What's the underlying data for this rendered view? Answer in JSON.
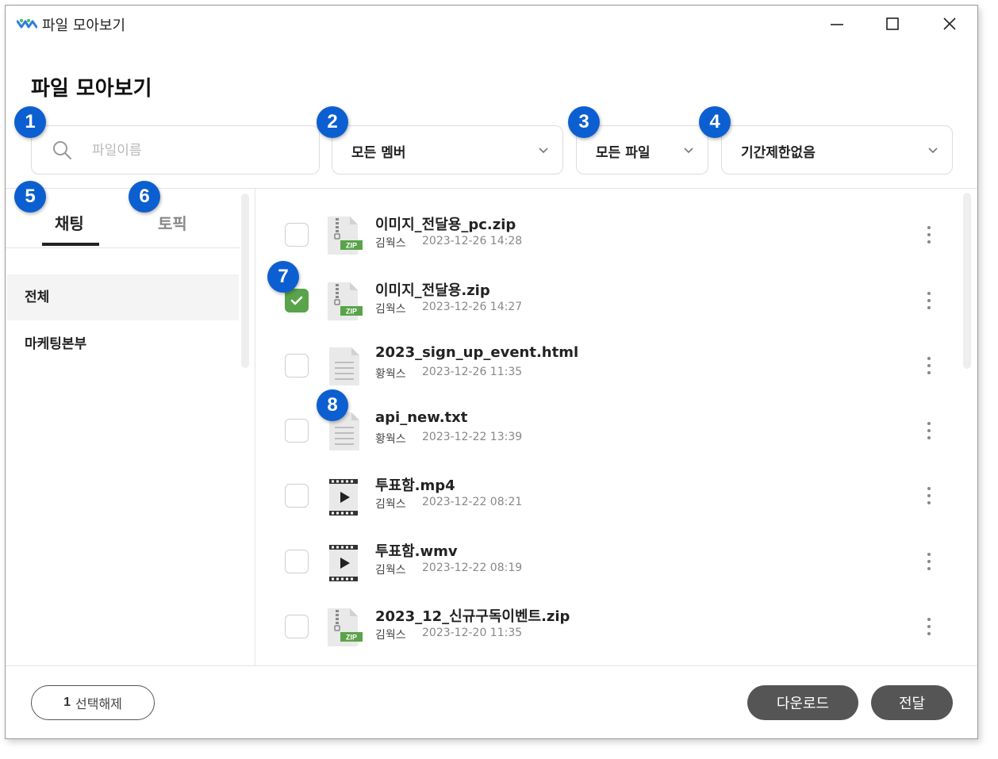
{
  "window": {
    "title": "파일 모아보기"
  },
  "page": {
    "title": "파일 모아보기"
  },
  "filters": {
    "search_placeholder": "파일이름",
    "member": "모든 멤버",
    "file_type": "모든 파일",
    "period": "기간제한없음"
  },
  "tabs": {
    "chat": "채팅",
    "topic": "토픽"
  },
  "sidebar": {
    "items": [
      {
        "label": "전체"
      },
      {
        "label": "마케팅본부"
      }
    ]
  },
  "files": [
    {
      "name": "이미지_전달용_pc.zip",
      "sender": "김웍스",
      "date": "2023-12-26 14:28",
      "icon": "zip-file-icon",
      "checked": false
    },
    {
      "name": "이미지_전달용.zip",
      "sender": "김웍스",
      "date": "2023-12-26 14:27",
      "icon": "zip-file-icon",
      "checked": true
    },
    {
      "name": "2023_sign_up_event.html",
      "sender": "황웍스",
      "date": "2023-12-26 11:35",
      "icon": "document-file-icon",
      "checked": false
    },
    {
      "name": "api_new.txt",
      "sender": "황웍스",
      "date": "2023-12-22 13:39",
      "icon": "document-file-icon",
      "checked": false
    },
    {
      "name": "투표함.mp4",
      "sender": "김웍스",
      "date": "2023-12-22 08:21",
      "icon": "video-file-icon",
      "checked": false
    },
    {
      "name": "투표함.wmv",
      "sender": "김웍스",
      "date": "2023-12-22 08:19",
      "icon": "video-file-icon",
      "checked": false
    },
    {
      "name": "2023_12_신규구독이벤트.zip",
      "sender": "김웍스",
      "date": "2023-12-20 11:35",
      "icon": "zip-file-icon",
      "checked": false
    }
  ],
  "footer": {
    "selected_count": "1",
    "deselect_label": "선택해제",
    "download_label": "다운로드",
    "forward_label": "전달"
  },
  "badges": [
    "1",
    "2",
    "3",
    "4",
    "5",
    "6",
    "7",
    "8"
  ],
  "colors": {
    "badge": "#0c5fd0",
    "checkbox_checked": "#5aa34a",
    "button_dark": "#555555",
    "zip_tag": "#5aa34a"
  }
}
